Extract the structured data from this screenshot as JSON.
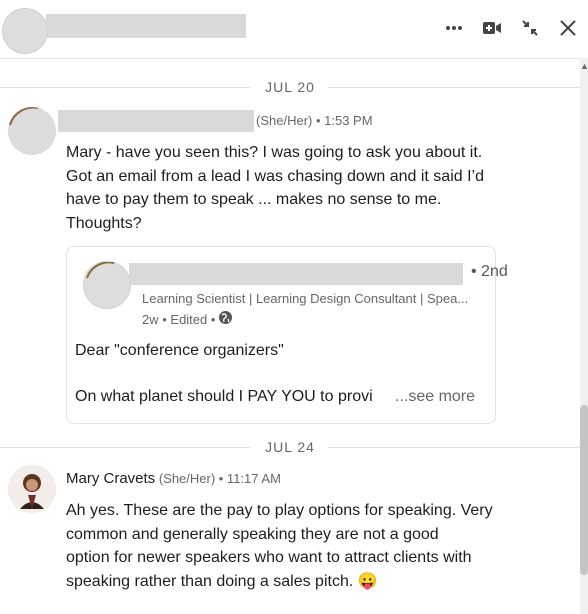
{
  "header": {
    "icons": [
      "more-icon",
      "video-icon",
      "minimize-icon",
      "close-icon"
    ]
  },
  "conversation": {
    "dividers": [
      {
        "label": "JUL 20"
      },
      {
        "label": "JUL 24"
      }
    ],
    "message1": {
      "pronouns_time": "(She/Her) • 1:53 PM",
      "lines": [
        "Mary - have you seen this? I was going to ask you about it.",
        "Got an email from a lead I was chasing down and it said I’d",
        "have to pay them to speak ... makes no sense to me.",
        "Thoughts?"
      ]
    },
    "shared_post": {
      "degree": "• 2nd",
      "headline": "Learning Scientist | Learning Design Consultant | Spea...",
      "time": "2w • Edited •",
      "body_line1": "Dear \"conference organizers\"",
      "body_line2": "On what planet should I PAY YOU to provi",
      "see_more": "...see more"
    },
    "message2": {
      "name": "Mary Cravets",
      "pronouns_time": "(She/Her) • 11:17 AM",
      "lines": [
        "Ah yes. These are the pay to play options for speaking. Very",
        "common and generally speaking they are not a good",
        "option for newer speakers who want to attract clients with",
        "speaking rather than doing a sales pitch. 😛"
      ]
    }
  }
}
